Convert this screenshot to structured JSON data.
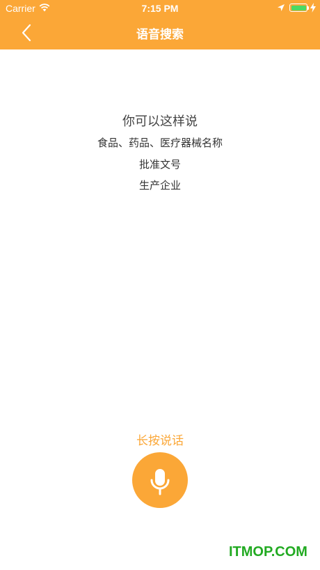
{
  "status_bar": {
    "carrier": "Carrier",
    "time": "7:15 PM",
    "battery_color": "#4CD964"
  },
  "nav": {
    "back_icon": "chevron-left-icon",
    "title": "语音搜索",
    "bar_color": "#FBA737"
  },
  "hints": {
    "title": "你可以这样说",
    "items": [
      "食品、药品、医疗器械名称",
      "批准文号",
      "生产企业"
    ]
  },
  "voice": {
    "label": "长按说话",
    "icon": "microphone-icon",
    "accent_color": "#FBA737"
  },
  "watermark": "ITMOP.COM"
}
